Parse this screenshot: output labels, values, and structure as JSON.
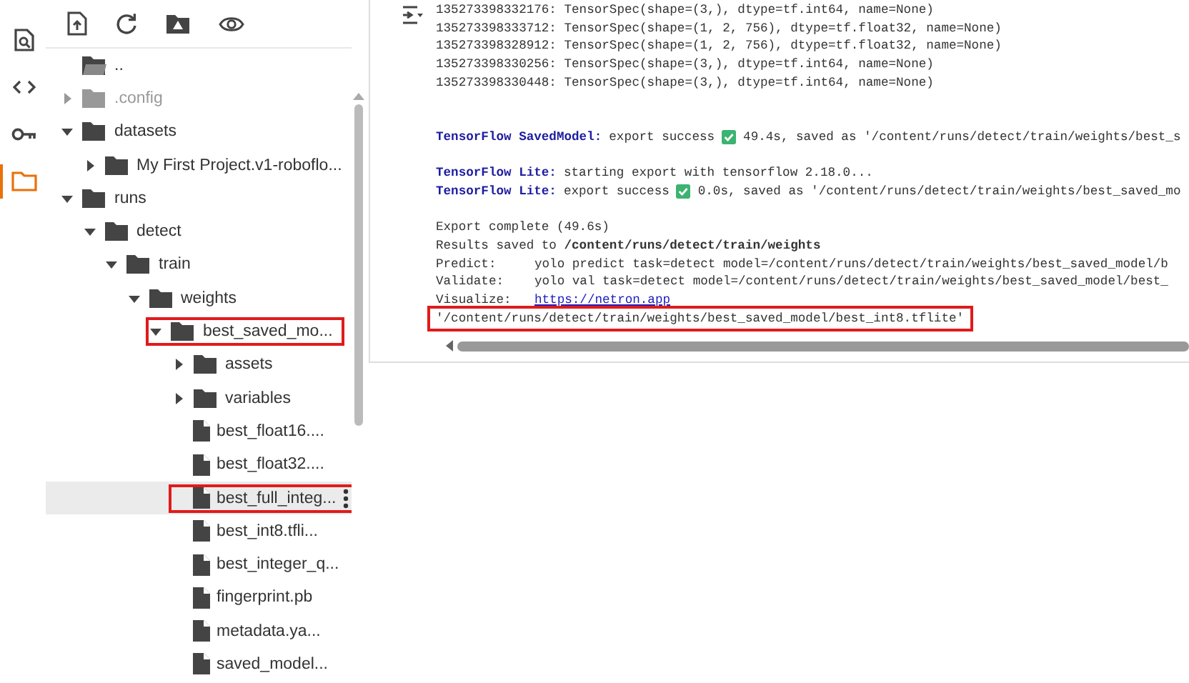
{
  "rail": [
    {
      "selected": false
    },
    {
      "selected": false
    },
    {
      "selected": false
    },
    {
      "selected": true
    }
  ],
  "tree": [
    {
      "kind": "parent",
      "name": ".."
    },
    {
      "kind": "folder",
      "name": ".config",
      "expanded": false,
      "dimmed": true
    },
    {
      "kind": "folder",
      "name": "datasets",
      "expanded": true,
      "children": [
        {
          "kind": "folder",
          "name": "My First Project.v1-roboflo...",
          "expanded": false
        }
      ]
    },
    {
      "kind": "folder",
      "name": "runs",
      "expanded": true,
      "children": [
        {
          "kind": "folder",
          "name": "detect",
          "expanded": true,
          "children": [
            {
              "kind": "folder",
              "name": "train",
              "expanded": true,
              "children": [
                {
                  "kind": "folder",
                  "name": "weights",
                  "expanded": true,
                  "children": [
                    {
                      "kind": "folder",
                      "name": "best_saved_mo...",
                      "expanded": true,
                      "highlighted": true,
                      "children": [
                        {
                          "kind": "folder",
                          "name": "assets",
                          "expanded": false
                        },
                        {
                          "kind": "folder",
                          "name": "variables",
                          "expanded": false
                        },
                        {
                          "kind": "file",
                          "name": "best_float16...."
                        },
                        {
                          "kind": "file",
                          "name": "best_float32...."
                        },
                        {
                          "kind": "file",
                          "name": "best_full_integ...",
                          "hovered": true,
                          "highlighted": true
                        },
                        {
                          "kind": "file",
                          "name": "best_int8.tfli..."
                        },
                        {
                          "kind": "file",
                          "name": "best_integer_q..."
                        },
                        {
                          "kind": "file",
                          "name": "fingerprint.pb"
                        },
                        {
                          "kind": "file",
                          "name": "metadata.ya..."
                        },
                        {
                          "kind": "file",
                          "name": "saved_model..."
                        }
                      ]
                    }
                  ]
                }
              ]
            }
          ]
        }
      ]
    }
  ],
  "output": [
    {
      "kind": "plain",
      "text": "135273398332176: TensorSpec(shape=(3,), dtype=tf.int64, name=None)"
    },
    {
      "kind": "plain",
      "text": "135273398333712: TensorSpec(shape=(1, 2, 756), dtype=tf.float32, name=None)"
    },
    {
      "kind": "plain",
      "text": "135273398328912: TensorSpec(shape=(1, 2, 756), dtype=tf.float32, name=None)"
    },
    {
      "kind": "plain",
      "text": "135273398330256: TensorSpec(shape=(3,), dtype=tf.int64, name=None)"
    },
    {
      "kind": "plain",
      "text": "135273398330448: TensorSpec(shape=(3,), dtype=tf.int64, name=None)"
    },
    {
      "kind": "blank"
    },
    {
      "kind": "blank"
    },
    {
      "kind": "tagged",
      "tag": "TensorFlow SavedModel:",
      "text": "export success",
      "check": true,
      "after": "49.4s, saved as '/content/runs/detect/train/weights/best_s"
    },
    {
      "kind": "blank"
    },
    {
      "kind": "tagged",
      "tag": "TensorFlow Lite:",
      "text": "starting export with tensorflow 2.18.0..."
    },
    {
      "kind": "tagged",
      "tag": "TensorFlow Lite:",
      "text": "export success",
      "check": true,
      "after": "0.0s, saved as '/content/runs/detect/train/weights/best_saved_mo"
    },
    {
      "kind": "blank"
    },
    {
      "kind": "plain",
      "text": "Export complete (49.6s)"
    },
    {
      "kind": "plain",
      "text": "Results saved to **/content/runs/detect/train/weights**"
    },
    {
      "kind": "kv",
      "key": "Predict:",
      "value": "yolo predict task=detect model=/content/runs/detect/train/weights/best_saved_model/b"
    },
    {
      "kind": "kv",
      "key": "Validate:",
      "value": "yolo val task=detect model=/content/runs/detect/train/weights/best_saved_model/best_"
    },
    {
      "kind": "link",
      "key": "Visualize:",
      "value": "https://netron.app"
    },
    {
      "kind": "result",
      "text": "'/content/runs/detect/train/weights/best_saved_model/best_int8.tflite'",
      "highlighted": true
    }
  ]
}
